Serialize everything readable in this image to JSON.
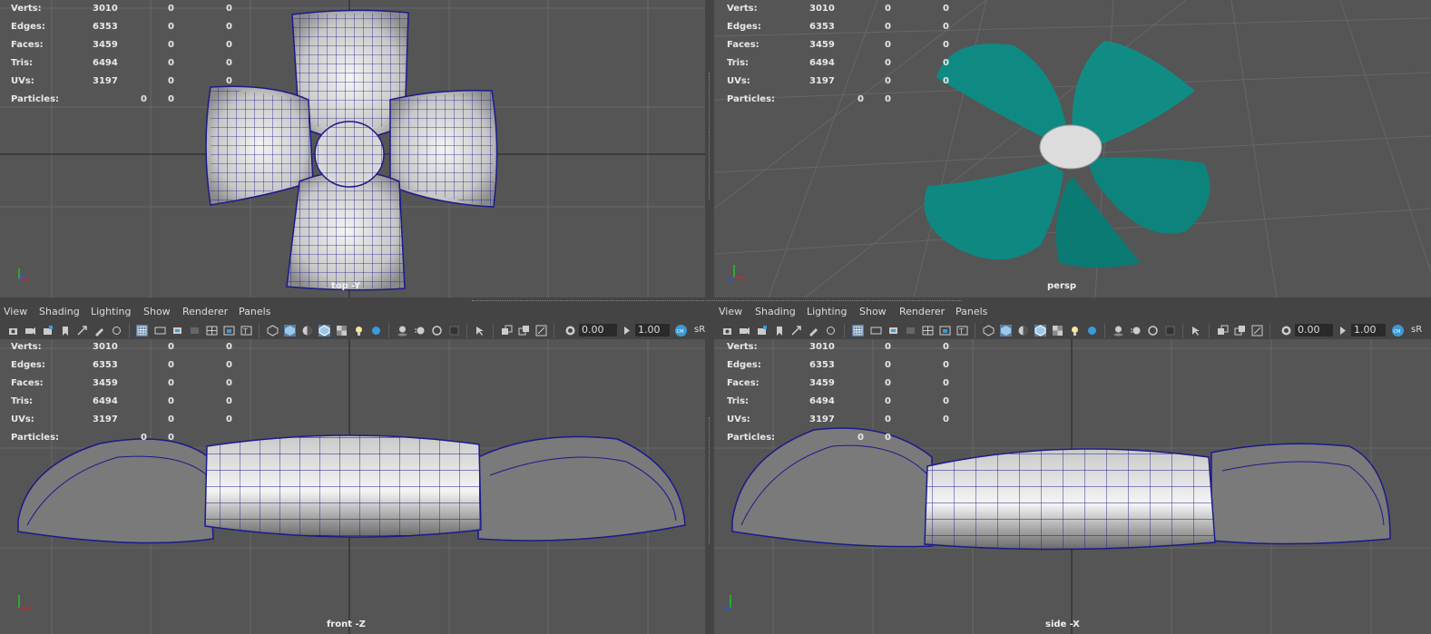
{
  "stats": [
    {
      "label": "Verts:",
      "value": "3010",
      "sel": "0",
      "tri": "0"
    },
    {
      "label": "Edges:",
      "value": "6353",
      "sel": "0",
      "tri": "0"
    },
    {
      "label": "Faces:",
      "value": "3459",
      "sel": "0",
      "tri": "0"
    },
    {
      "label": "Tris:",
      "value": "6494",
      "sel": "0",
      "tri": "0"
    },
    {
      "label": "UVs:",
      "value": "3197",
      "sel": "0",
      "tri": "0"
    },
    {
      "label": "Particles:",
      "sel": "0",
      "tri": "0"
    }
  ],
  "viewports": {
    "top": {
      "camera": "top -Y"
    },
    "persp": {
      "camera": "persp"
    },
    "front": {
      "camera": "front -Z"
    },
    "side": {
      "camera": "side -X"
    }
  },
  "panel_menu": [
    "View",
    "Shading",
    "Lighting",
    "Show",
    "Renderer",
    "Panels"
  ],
  "toolbar": {
    "near_clip": "0.00",
    "gamma": "1.00",
    "color_space": "sR",
    "icons": [
      "select-camera-icon",
      "camera-attributes-icon",
      "bookmark-icon",
      "image-plane-icon",
      "2d-pan-zoom-icon",
      "grease-pencil-icon",
      "grid-icon",
      "film-gate-icon",
      "resolution-gate-icon",
      "gate-mask-icon",
      "field-chart-icon",
      "safe-action-icon",
      "safe-title-icon",
      "wireframe-icon",
      "smooth-shade-icon",
      "use-default-material-icon",
      "wireframe-on-shaded-icon",
      "textured-icon",
      "use-all-lights-icon",
      "shadows-icon",
      "screen-space-ao-icon",
      "motion-blur-icon",
      "multisample-aa-icon",
      "depth-of-field-icon",
      "isolate-select-icon",
      "xray-icon",
      "xray-active-components-icon",
      "xray-joints-icon",
      "exposure-icon",
      "gamma-icon",
      "color-management-icon"
    ]
  },
  "colors": {
    "viewport_bg": "#555555",
    "grid": "#666666",
    "wire": "#1a1a8c",
    "petal_teal": "#0f8a82"
  }
}
